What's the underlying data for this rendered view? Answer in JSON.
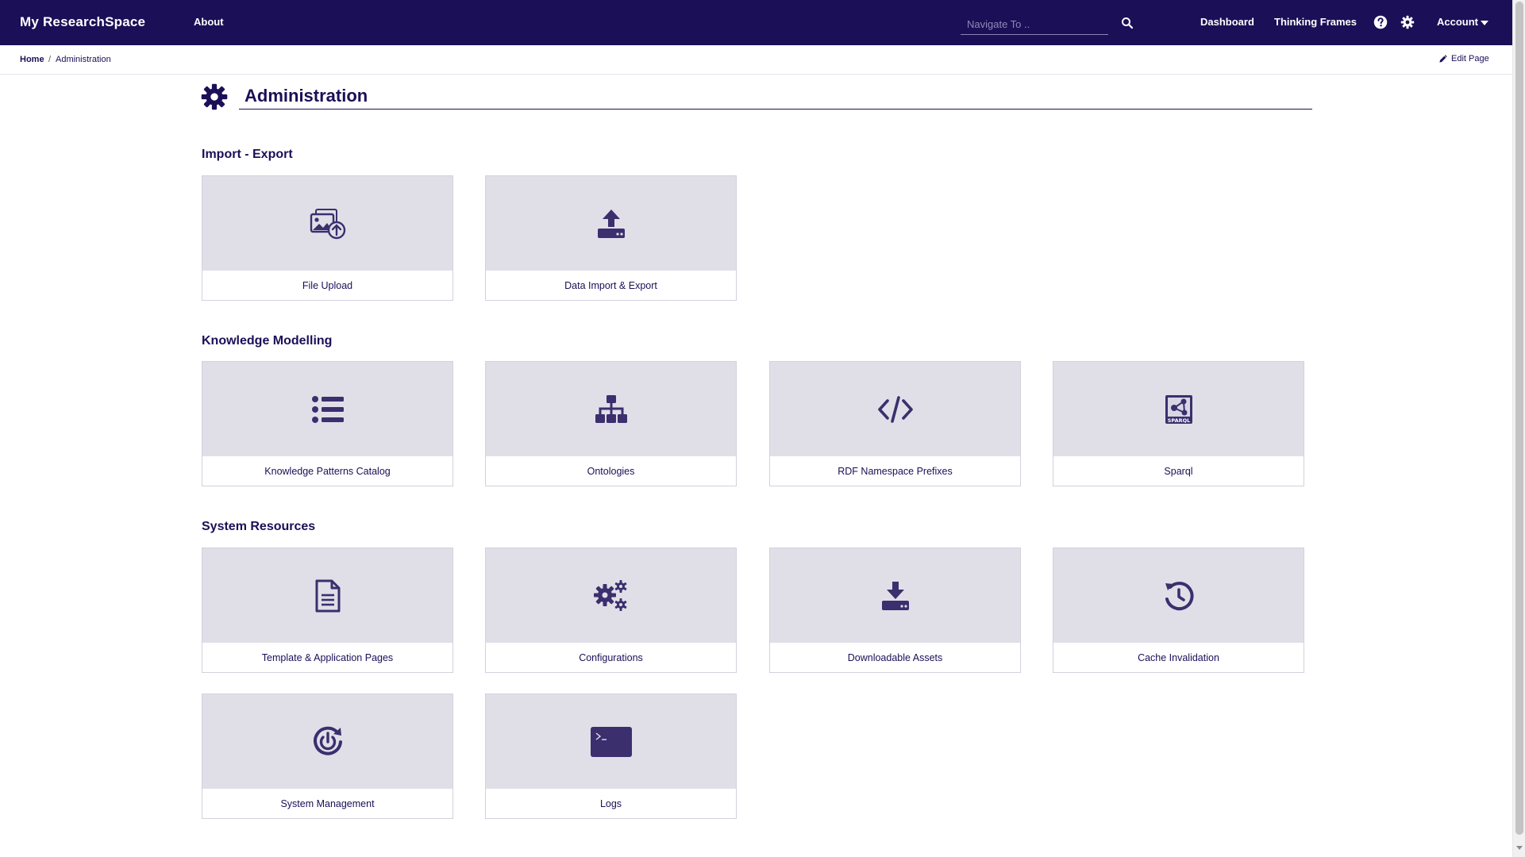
{
  "navbar": {
    "brand": "My ResearchSpace",
    "about": "About",
    "search_placeholder": "Navigate To ..",
    "dashboard": "Dashboard",
    "thinking_frames": "Thinking Frames",
    "account": "Account",
    "background": "#1b0f57"
  },
  "breadcrumb": {
    "home": "Home",
    "separator": "/",
    "current": "Administration",
    "edit_page": "Edit Page"
  },
  "page": {
    "title": "Administration",
    "accent": "#1b0f57",
    "tile_background": "#e0dfe8"
  },
  "sections": [
    {
      "title": "Import - Export",
      "tiles": [
        {
          "label": "File Upload",
          "icon": "image-upload-icon"
        },
        {
          "label": "Data Import & Export",
          "icon": "upload-tray-icon"
        }
      ]
    },
    {
      "title": "Knowledge Modelling",
      "tiles": [
        {
          "label": "Knowledge Patterns Catalog",
          "icon": "list-icon"
        },
        {
          "label": "Ontologies",
          "icon": "sitemap-icon"
        },
        {
          "label": "RDF Namespace Prefixes",
          "icon": "code-icon"
        },
        {
          "label": "Sparql",
          "icon": "sparql-icon",
          "icon_text": "SPARQL"
        }
      ]
    },
    {
      "title": "System Resources",
      "tiles": [
        {
          "label": "Template & Application Pages",
          "icon": "document-icon"
        },
        {
          "label": "Configurations",
          "icon": "gears-icon"
        },
        {
          "label": "Downloadable Assets",
          "icon": "download-tray-icon"
        },
        {
          "label": "Cache Invalidation",
          "icon": "history-icon"
        },
        {
          "label": "System Management",
          "icon": "power-cycle-icon"
        },
        {
          "label": "Logs",
          "icon": "terminal-icon"
        }
      ]
    }
  ]
}
